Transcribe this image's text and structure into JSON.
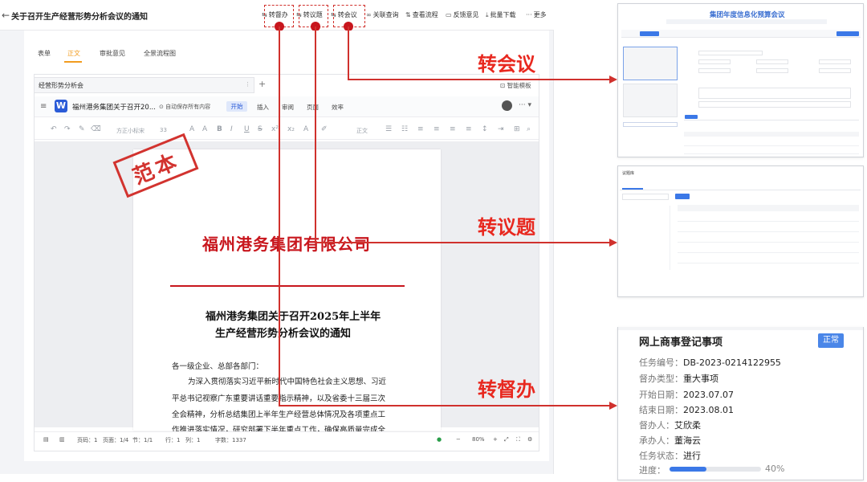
{
  "topbar": {
    "back_icon": "arrow-left-icon",
    "title": "关于召开生产经营形势分析会议的通知",
    "actions": [
      {
        "icon": "transfer-icon",
        "label": "转督办"
      },
      {
        "icon": "transfer-icon",
        "label": "转议题"
      },
      {
        "icon": "transfer-icon",
        "label": "转会议"
      },
      {
        "icon": "link-icon",
        "label": "关联查询"
      },
      {
        "icon": "flow-icon",
        "label": "查看流程"
      },
      {
        "icon": "feedback-icon",
        "label": "反馈意见"
      },
      {
        "icon": "download-icon",
        "label": "批量下载"
      },
      {
        "icon": "more-icon",
        "label": "更多"
      }
    ]
  },
  "tabs": [
    "表单",
    "正文",
    "审批意见",
    "全景流程图"
  ],
  "active_tab": "正文",
  "pane": {
    "tab_label": "经营形势分析会",
    "smart_label": "智能模板",
    "wps_title": "福州港务集团关于召开20...",
    "autosave": "自动保存所有内容",
    "ribbon": [
      "开始",
      "插入",
      "审阅",
      "页面",
      "效率"
    ],
    "font_name": "方正小标宋",
    "font_size": "33",
    "body_style": "正文"
  },
  "document": {
    "stamp": "范本",
    "company": "福州港务集团有限公司",
    "heading_1": "福州港务集团关于召开2025年上半年",
    "heading_2": "生产经营形势分析会议的通知",
    "lines": [
      "各一级企业、总部各部门：",
      "为深入贯彻落实习近平新时代中国特色社会主义思想、习近",
      "平总书记视察广东重要讲话重要指示精神，以及省委十三届三次",
      "全会精神，分析总结集团上半年生产经营总体情况及各项重点工",
      "作推进落实情况，研究部署下半年重点工作，确保高质量完成全"
    ]
  },
  "statusbar": {
    "page": "页码：1",
    "pages": "页面：1/4",
    "section": "节：1/1",
    "row": "行：1",
    "col": "列：1",
    "words": "字数：1337",
    "zoom": "80%"
  },
  "callouts": {
    "meeting": "转会议",
    "topic": "转议题",
    "supervise": "转督办"
  },
  "panel_meeting": {
    "title": "集团年度信息化预算会议"
  },
  "panel_topic": {
    "title": "议题库"
  },
  "panel_supervise": {
    "title": "网上商事登记事项",
    "status_badge": "正常",
    "fields": [
      {
        "label": "任务编号：",
        "value": "DB-2023-0214122955"
      },
      {
        "label": "督办类型：",
        "value": "重大事项"
      },
      {
        "label": "开始日期：",
        "value": "2023.07.07"
      },
      {
        "label": "结束日期：",
        "value": "2023.08.01"
      },
      {
        "label": "督办人：",
        "value": "艾欣柔"
      },
      {
        "label": "承办人：",
        "value": "董海云"
      },
      {
        "label": "任务状态：",
        "value": "进行"
      }
    ],
    "progress_label": "进度：",
    "progress": 0.4,
    "progress_text": "40%"
  }
}
